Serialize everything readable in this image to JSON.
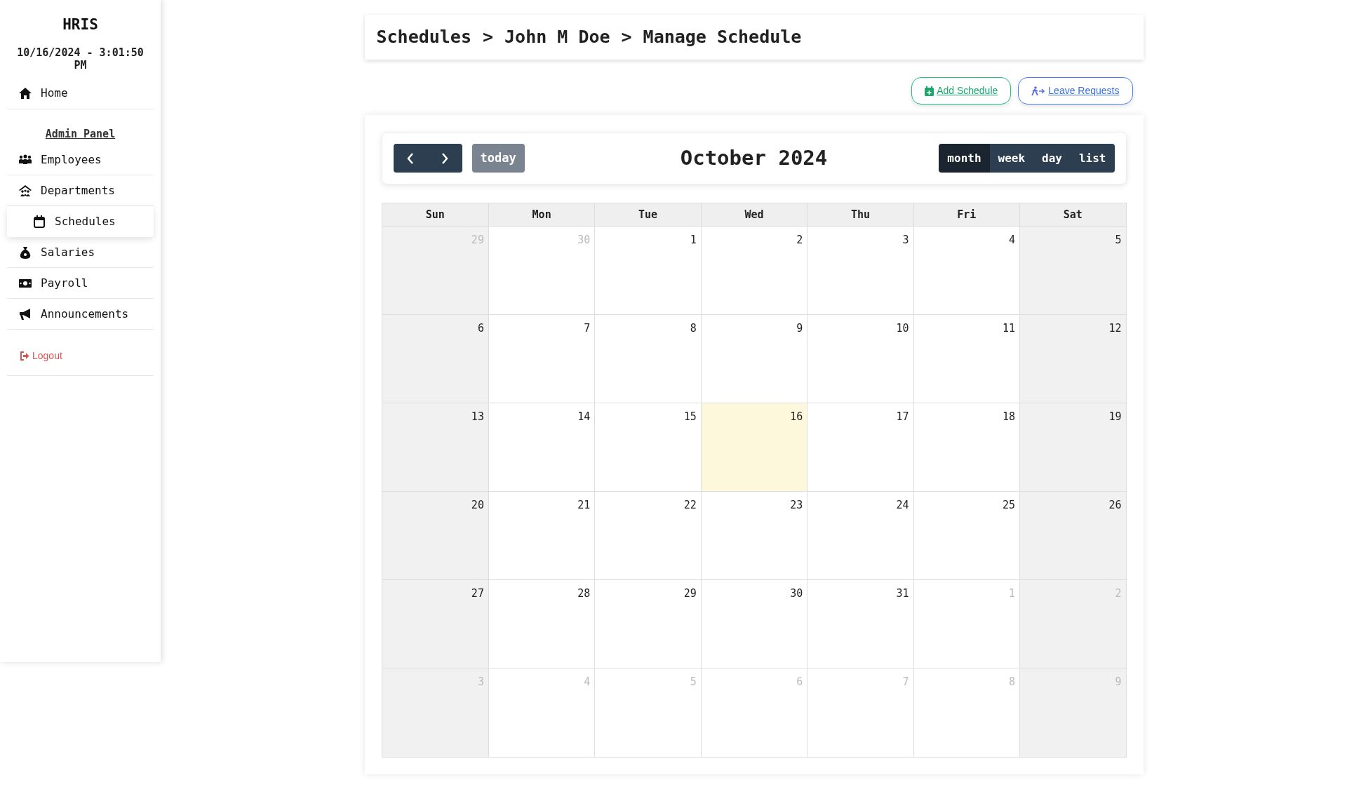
{
  "sidebar": {
    "title": "HRIS",
    "datetime": "10/16/2024 - 3:01:50 PM",
    "items": [
      {
        "label": "Home",
        "selected": false
      },
      {
        "kind": "heading",
        "label": "Admin Panel"
      },
      {
        "label": "Employees",
        "selected": false
      },
      {
        "label": "Departments",
        "selected": false
      },
      {
        "label": "Schedules",
        "selected": true
      },
      {
        "label": "Salaries",
        "selected": false
      },
      {
        "label": "Payroll",
        "selected": false
      },
      {
        "label": "Announcements",
        "selected": false
      },
      {
        "kind": "logout",
        "label": "Logout"
      }
    ]
  },
  "breadcrumb": [
    "Schedules",
    "John M Doe",
    "Manage Schedule"
  ],
  "breadcrumb_separator": ">",
  "actions": [
    "Add Schedule",
    "Leave Requests"
  ],
  "calendar": {
    "title": "October 2024",
    "today_label": "today",
    "views": [
      {
        "label": "month",
        "selected": true
      },
      {
        "label": "week",
        "selected": false
      },
      {
        "label": "day",
        "selected": false
      },
      {
        "label": "list",
        "selected": false
      }
    ],
    "columns": [
      "Sun",
      "Mon",
      "Tue",
      "Wed",
      "Thu",
      "Fri",
      "Sat"
    ],
    "weeks": [
      [
        {
          "day": "29",
          "other_month": true
        },
        {
          "day": "30",
          "other_month": true
        },
        {
          "day": "1",
          "other_month": false
        },
        {
          "day": "2",
          "other_month": false
        },
        {
          "day": "3",
          "other_month": false
        },
        {
          "day": "4",
          "other_month": false
        },
        {
          "day": "5",
          "other_month": false
        }
      ],
      [
        {
          "day": "6",
          "other_month": false
        },
        {
          "day": "7",
          "other_month": false
        },
        {
          "day": "8",
          "other_month": false
        },
        {
          "day": "9",
          "other_month": false
        },
        {
          "day": "10",
          "other_month": false
        },
        {
          "day": "11",
          "other_month": false
        },
        {
          "day": "12",
          "other_month": false
        }
      ],
      [
        {
          "day": "13",
          "other_month": false
        },
        {
          "day": "14",
          "other_month": false
        },
        {
          "day": "15",
          "other_month": false
        },
        {
          "day": "16",
          "other_month": false,
          "today": true
        },
        {
          "day": "17",
          "other_month": false
        },
        {
          "day": "18",
          "other_month": false
        },
        {
          "day": "19",
          "other_month": false
        }
      ],
      [
        {
          "day": "20",
          "other_month": false
        },
        {
          "day": "21",
          "other_month": false
        },
        {
          "day": "22",
          "other_month": false
        },
        {
          "day": "23",
          "other_month": false
        },
        {
          "day": "24",
          "other_month": false
        },
        {
          "day": "25",
          "other_month": false
        },
        {
          "day": "26",
          "other_month": false
        }
      ],
      [
        {
          "day": "27",
          "other_month": false
        },
        {
          "day": "28",
          "other_month": false
        },
        {
          "day": "29",
          "other_month": false
        },
        {
          "day": "30",
          "other_month": false
        },
        {
          "day": "31",
          "other_month": false
        },
        {
          "day": "1",
          "other_month": true
        },
        {
          "day": "2",
          "other_month": true
        }
      ],
      [
        {
          "day": "3",
          "other_month": true
        },
        {
          "day": "4",
          "other_month": true
        },
        {
          "day": "5",
          "other_month": true
        },
        {
          "day": "6",
          "other_month": true
        },
        {
          "day": "7",
          "other_month": true
        },
        {
          "day": "8",
          "other_month": true
        },
        {
          "day": "9",
          "other_month": true
        }
      ]
    ]
  }
}
